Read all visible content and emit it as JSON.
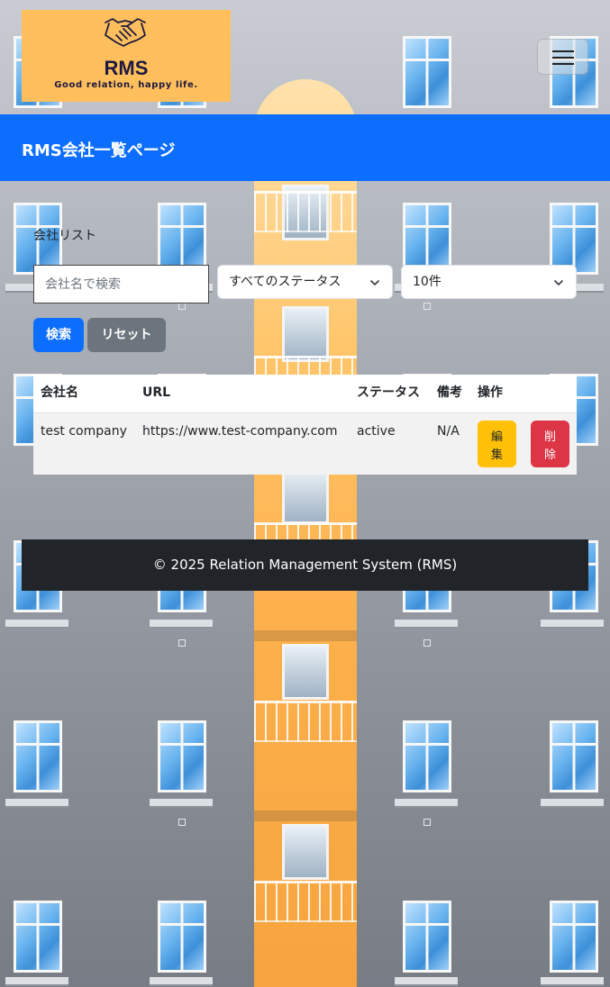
{
  "header": {
    "brand": "RMS",
    "tagline": "Good relation, happy life.",
    "menu_icon": "hamburger-icon",
    "logo_icon": "handshake-icon"
  },
  "page": {
    "title": "RMS会社一覧ページ",
    "section_label": "会社リスト"
  },
  "search": {
    "placeholder": "会社名で検索",
    "value": "",
    "status_selected": "すべてのステータス",
    "per_page_selected": "10件",
    "search_button": "検索",
    "reset_button": "リセット"
  },
  "table": {
    "headers": {
      "name": "会社名",
      "url": "URL",
      "status": "ステータス",
      "note": "備考",
      "actions": "操作"
    },
    "rows": [
      {
        "name": "test company",
        "url": "https://www.test-company.com",
        "status": "active",
        "note": "N/A",
        "edit_label": "編集",
        "delete_label": "削除"
      }
    ]
  },
  "footer": {
    "text": "© 2025 Relation Management System (RMS)"
  },
  "colors": {
    "primary": "#0d6efd",
    "secondary": "#6c757d",
    "warning": "#ffc107",
    "danger": "#dc3545",
    "dark": "#212529",
    "logo_bg": "#ffbf5c"
  }
}
